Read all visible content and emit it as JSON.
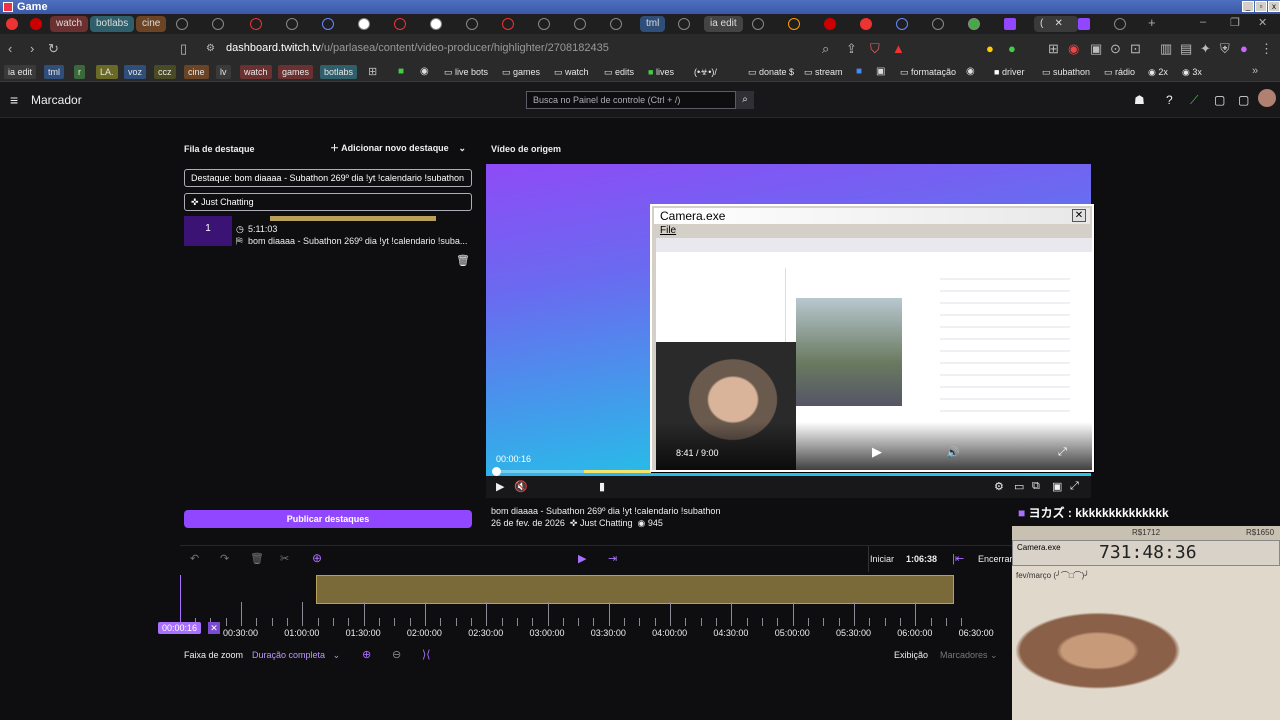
{
  "window": {
    "title": "Game"
  },
  "tabs": [
    "watch",
    "botlabs",
    "cine",
    "tml",
    "ia edit"
  ],
  "address": {
    "url_host": "dashboard.twitch.tv",
    "url_path": "/u/parlasea/content/video-producer/highlighter/2708182435"
  },
  "bookmarks": [
    "ia edit",
    "tml",
    "r",
    "LA.",
    "voz",
    "ccz",
    "cine",
    "lv",
    "watch",
    "games",
    "botlabs",
    "live bots",
    "games",
    "watch",
    "edits",
    "lives",
    "(•☣•)/",
    "donate $",
    "stream",
    "formatação",
    "driver",
    "subathon",
    "rádio",
    "2x",
    "3x"
  ],
  "header": {
    "menu_title": "Marcador",
    "search_placeholder": "Busca no Painel de controle (Ctrl + /)"
  },
  "queue": {
    "title": "Fila de destaque",
    "add_button": "Adicionar novo destaque",
    "title_field": "Destaque: bom diaaaa - Subathon 269º dia !yt !calendario !subathon",
    "category": "Just Chatting",
    "item": {
      "number": "1",
      "duration": "5:11:03",
      "title": "bom diaaaa - Subathon 269º dia !yt !calendario !suba..."
    },
    "publish_button": "Publicar destaques"
  },
  "source": {
    "title": "Vídeo de origem",
    "timestamp": "00:00:16",
    "video_title": "bom diaaaa - Subathon 269º dia !yt !calendario !subathon",
    "date": "26 de fev. de 2026",
    "category": "Just Chatting",
    "views": "945"
  },
  "camera_window": {
    "title": "Camera.exe",
    "menu": "File",
    "player_time": "8:41 / 9:00"
  },
  "timeline": {
    "start_label": "Iniciar",
    "start_value": "1:06:38",
    "end_label": "Encerrar",
    "playhead": "00:00:16",
    "labels": [
      "00:30:00",
      "01:00:00",
      "01:30:00",
      "02:00:00",
      "02:30:00",
      "03:00:00",
      "03:30:00",
      "04:00:00",
      "04:30:00",
      "05:00:00",
      "05:30:00",
      "06:00:00",
      "06:30:00"
    ],
    "zoom_label": "Faixa de zoom",
    "zoom_value": "Duração completa",
    "view_label": "Exibição",
    "markers_label": "Marcadores"
  },
  "overlay": {
    "chat_text": "ヨカズ : kkkkkkkkkkkkkk",
    "camera_title": "Camera.exe",
    "timer": "731:48:36",
    "goal_left": "R$1712",
    "goal_right": "R$1650",
    "month_label": "fev/março (╯⌒□⌒)╯"
  },
  "colors": {
    "accent": "#9147ff",
    "highlight": "#b8a05a",
    "bg": "#0e0e10"
  }
}
